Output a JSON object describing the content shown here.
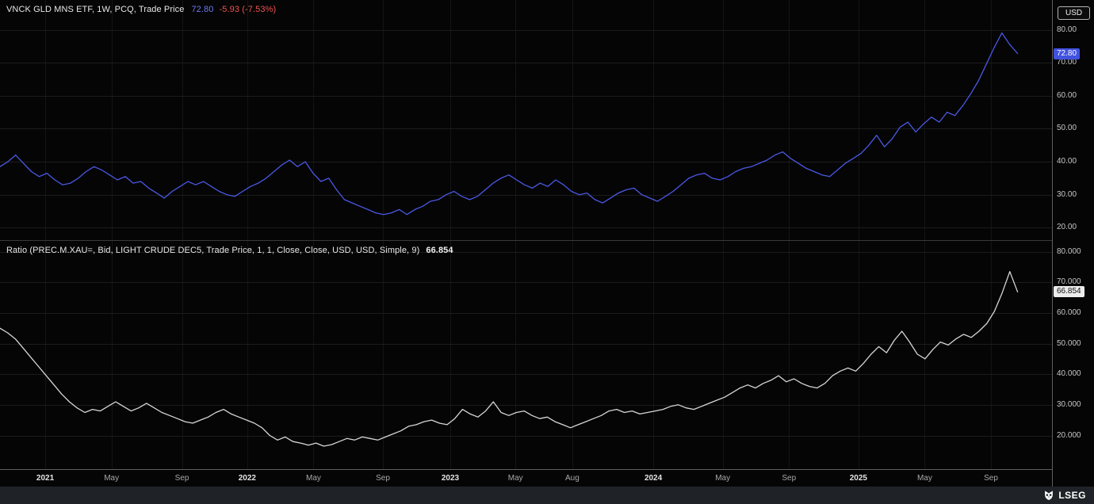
{
  "y_axis": {
    "currency_button": "USD"
  },
  "footer": {
    "brand": "LSEG"
  },
  "chart_data": [
    {
      "type": "line",
      "panel": "top",
      "title": "VNCK GLD MNS ETF, 1W, PCQ, Trade Price",
      "last_label": "72.80",
      "change_label": "-5.93 (-7.53%)",
      "last_value": 72.8,
      "color": "#4a58e6",
      "badge": {
        "bg": "#4152e0",
        "fg": "#ffffff"
      },
      "ylim": [
        16,
        89
      ],
      "yticks": [
        {
          "v": 80,
          "label": "80.00"
        },
        {
          "v": 70,
          "label": "70.00"
        },
        {
          "v": 60,
          "label": "60.00"
        },
        {
          "v": 50,
          "label": "50.00"
        },
        {
          "v": 40,
          "label": "40.00"
        },
        {
          "v": 30,
          "label": "30.00"
        },
        {
          "v": 20,
          "label": "20.00"
        }
      ],
      "series_end_fraction": 0.968,
      "x_ticks": [
        {
          "label": "2021",
          "pos": 0.043,
          "year": true
        },
        {
          "label": "May",
          "pos": 0.106,
          "year": false
        },
        {
          "label": "Sep",
          "pos": 0.173,
          "year": false
        },
        {
          "label": "2022",
          "pos": 0.235,
          "year": true
        },
        {
          "label": "May",
          "pos": 0.298,
          "year": false
        },
        {
          "label": "Sep",
          "pos": 0.364,
          "year": false
        },
        {
          "label": "2023",
          "pos": 0.428,
          "year": true
        },
        {
          "label": "May",
          "pos": 0.49,
          "year": false
        },
        {
          "label": "Aug",
          "pos": 0.544,
          "year": false
        },
        {
          "label": "2024",
          "pos": 0.621,
          "year": true
        },
        {
          "label": "May",
          "pos": 0.687,
          "year": false
        },
        {
          "label": "Sep",
          "pos": 0.75,
          "year": false
        },
        {
          "label": "2025",
          "pos": 0.816,
          "year": true
        },
        {
          "label": "May",
          "pos": 0.879,
          "year": false
        },
        {
          "label": "Sep",
          "pos": 0.942,
          "year": false
        }
      ],
      "values": [
        38.5,
        40.0,
        42.0,
        39.5,
        37.0,
        35.5,
        36.5,
        34.5,
        33.0,
        33.5,
        35.0,
        37.0,
        38.5,
        37.5,
        36.0,
        34.5,
        35.5,
        33.5,
        34.0,
        32.0,
        30.5,
        29.0,
        31.0,
        32.5,
        34.0,
        33.0,
        34.0,
        32.5,
        31.0,
        30.0,
        29.5,
        31.0,
        32.5,
        33.5,
        35.0,
        37.0,
        39.0,
        40.5,
        38.5,
        40.0,
        36.5,
        34.0,
        35.0,
        31.5,
        28.5,
        27.5,
        26.5,
        25.5,
        24.5,
        24.0,
        24.5,
        25.5,
        24.0,
        25.5,
        26.5,
        28.0,
        28.5,
        30.0,
        31.0,
        29.5,
        28.5,
        29.5,
        31.5,
        33.5,
        35.0,
        36.0,
        34.5,
        33.0,
        32.0,
        33.5,
        32.5,
        34.5,
        33.0,
        31.0,
        30.0,
        30.5,
        28.5,
        27.5,
        29.0,
        30.5,
        31.5,
        32.0,
        30.0,
        29.0,
        28.0,
        29.5,
        31.0,
        33.0,
        35.0,
        36.0,
        36.5,
        35.0,
        34.5,
        35.5,
        37.0,
        38.0,
        38.5,
        39.5,
        40.5,
        42.0,
        43.0,
        41.0,
        39.5,
        38.0,
        37.0,
        36.0,
        35.5,
        37.5,
        39.5,
        41.0,
        42.5,
        45.0,
        48.0,
        44.5,
        47.0,
        50.5,
        52.0,
        49.0,
        51.5,
        53.5,
        52.0,
        55.0,
        54.0,
        57.0,
        60.5,
        64.5,
        69.5,
        74.5,
        79.0,
        75.5,
        72.8
      ]
    },
    {
      "type": "line",
      "panel": "bottom",
      "title": "Ratio (PREC.M.XAU=, Bid, LIGHT CRUDE DEC5, Trade Price, 1, 1, Close, Close, USD, USD, Simple, 9)",
      "last_label": "66.854",
      "last_value": 66.854,
      "color": "#d6d6d6",
      "badge": {
        "bg": "#ececec",
        "fg": "#101010"
      },
      "ylim": [
        9,
        83.5
      ],
      "yticks": [
        {
          "v": 80,
          "label": "80.000"
        },
        {
          "v": 70,
          "label": "70.000"
        },
        {
          "v": 60,
          "label": "60.000"
        },
        {
          "v": 50,
          "label": "50.000"
        },
        {
          "v": 40,
          "label": "40.000"
        },
        {
          "v": 30,
          "label": "30.000"
        },
        {
          "v": 20,
          "label": "20.000"
        }
      ],
      "series_end_fraction": 0.968,
      "x_ticks": [
        {
          "label": "2021",
          "pos": 0.043,
          "year": true
        },
        {
          "label": "May",
          "pos": 0.106,
          "year": false
        },
        {
          "label": "Sep",
          "pos": 0.173,
          "year": false
        },
        {
          "label": "2022",
          "pos": 0.235,
          "year": true
        },
        {
          "label": "May",
          "pos": 0.298,
          "year": false
        },
        {
          "label": "Sep",
          "pos": 0.364,
          "year": false
        },
        {
          "label": "2023",
          "pos": 0.428,
          "year": true
        },
        {
          "label": "May",
          "pos": 0.49,
          "year": false
        },
        {
          "label": "Aug",
          "pos": 0.544,
          "year": false
        },
        {
          "label": "2024",
          "pos": 0.621,
          "year": true
        },
        {
          "label": "May",
          "pos": 0.687,
          "year": false
        },
        {
          "label": "Sep",
          "pos": 0.75,
          "year": false
        },
        {
          "label": "2025",
          "pos": 0.816,
          "year": true
        },
        {
          "label": "May",
          "pos": 0.879,
          "year": false
        },
        {
          "label": "Sep",
          "pos": 0.942,
          "year": false
        }
      ],
      "values": [
        55.0,
        53.5,
        51.5,
        48.5,
        45.5,
        42.5,
        39.5,
        36.5,
        33.5,
        31.0,
        29.0,
        27.5,
        28.5,
        28.0,
        29.5,
        31.0,
        29.5,
        28.0,
        29.0,
        30.5,
        29.0,
        27.5,
        26.5,
        25.5,
        24.5,
        24.0,
        25.0,
        26.0,
        27.5,
        28.5,
        27.0,
        26.0,
        25.0,
        24.0,
        22.5,
        20.0,
        18.5,
        19.5,
        18.0,
        17.5,
        16.8,
        17.5,
        16.5,
        17.0,
        18.0,
        19.0,
        18.5,
        19.5,
        19.0,
        18.5,
        19.5,
        20.5,
        21.5,
        23.0,
        23.5,
        24.5,
        25.0,
        24.0,
        23.5,
        25.5,
        28.5,
        27.0,
        26.0,
        28.0,
        31.0,
        27.5,
        26.5,
        27.5,
        28.0,
        26.5,
        25.5,
        26.0,
        24.5,
        23.5,
        22.5,
        23.5,
        24.5,
        25.5,
        26.5,
        28.0,
        28.5,
        27.5,
        28.0,
        27.0,
        27.5,
        28.0,
        28.5,
        29.5,
        30.0,
        29.0,
        28.5,
        29.5,
        30.5,
        31.5,
        32.5,
        34.0,
        35.5,
        36.5,
        35.5,
        37.0,
        38.0,
        39.5,
        37.5,
        38.5,
        37.0,
        36.0,
        35.5,
        37.0,
        39.5,
        41.0,
        42.0,
        41.0,
        43.5,
        46.5,
        49.0,
        47.0,
        51.0,
        54.0,
        50.5,
        46.5,
        45.0,
        48.0,
        50.5,
        49.5,
        51.5,
        53.0,
        52.0,
        54.0,
        56.5,
        60.5,
        66.5,
        73.5,
        66.854
      ]
    }
  ]
}
